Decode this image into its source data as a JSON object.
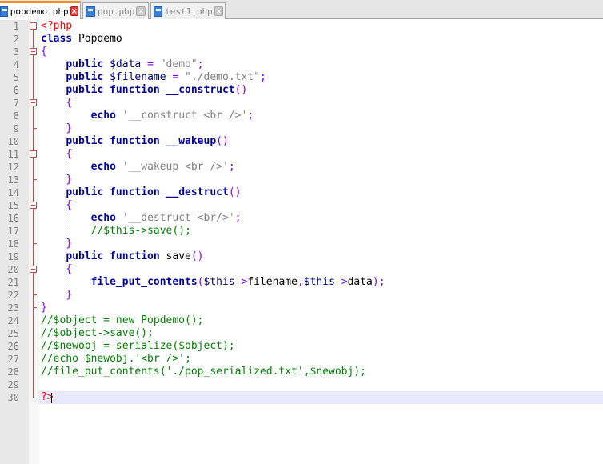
{
  "tabs": [
    {
      "label": "popdemo.php",
      "active": true
    },
    {
      "label": "pop.php",
      "active": false
    },
    {
      "label": "test1.php",
      "active": false
    }
  ],
  "line_numbers": [
    "1",
    "2",
    "3",
    "4",
    "5",
    "6",
    "7",
    "8",
    "9",
    "10",
    "11",
    "12",
    "13",
    "14",
    "15",
    "16",
    "17",
    "18",
    "19",
    "20",
    "21",
    "22",
    "23",
    "24",
    "25",
    "26",
    "27",
    "28",
    "29",
    "30"
  ],
  "code": {
    "l1_open": "<?php",
    "l2_kw": "class",
    "l2_name": " Popdemo",
    "l3_brace": "{",
    "l4_kw": "public",
    "l4_var": " $data",
    "l4_eq": " = ",
    "l4_str": "\"demo\"",
    "l4_semi": ";",
    "l5_kw": "public",
    "l5_var": " $filename",
    "l5_eq": " = ",
    "l5_str": "\"./demo.txt\"",
    "l5_semi": ";",
    "l6_kw": "public function",
    "l6_fn": " __construct",
    "l6_par": "()",
    "l7_brace": "{",
    "l8_kw": "echo",
    "l8_str": " '__construct <br />'",
    "l8_semi": ";",
    "l9_brace": "}",
    "l10_kw": "public function",
    "l10_fn": " __wakeup",
    "l10_par": "()",
    "l11_brace": "{",
    "l12_kw": "echo",
    "l12_str": " '__wakeup <br />'",
    "l12_semi": ";",
    "l13_brace": "}",
    "l14_kw": "public function",
    "l14_fn": " __destruct",
    "l14_par": "()",
    "l15_brace": "{",
    "l16_kw": "echo",
    "l16_str": " '__destruct <br/>'",
    "l16_semi": ";",
    "l17_cmt": "//$this->save();",
    "l18_brace": "}",
    "l19_kw": "public function",
    "l19_fn": " save",
    "l19_par": "()",
    "l20_brace": "{",
    "l21_fn": "file_put_contents",
    "l21_p1": "(",
    "l21_v1": "$this",
    "l21_a1": "->",
    "l21_t1": "filename",
    "l21_c": ",",
    "l21_v2": "$this",
    "l21_a2": "->",
    "l21_t2": "data",
    "l21_p2": ");",
    "l22_brace": "}",
    "l23_brace": "}",
    "l24_cmt": "//$object = new Popdemo();",
    "l25_cmt": "//$object->save();",
    "l26_cmt": "//$newobj = serialize($object);",
    "l27_cmt": "//echo $newobj.'<br />';",
    "l28_cmt": "//file_put_contents('./pop_serialized.txt',$newobj);",
    "l30_close": "?>"
  },
  "colors": {
    "keyword": "#0000a0",
    "string": "#808080",
    "comment": "#008000",
    "operator": "#8000ff",
    "php_tag": "#ff0000",
    "active_tab_accent": "#fa8c2a"
  }
}
